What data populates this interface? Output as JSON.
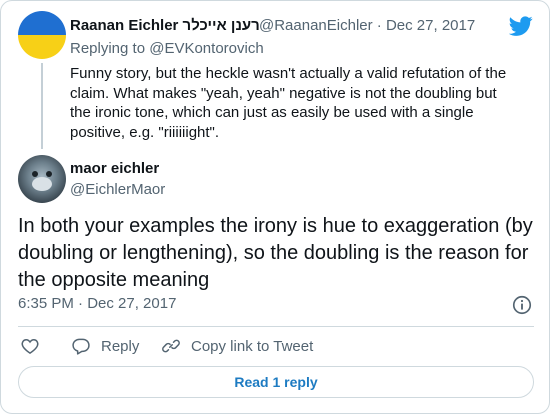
{
  "parent_tweet": {
    "display_name": "Raanan Eichler רענן אייכלר",
    "handle": "@RaananEichler",
    "separator": "·",
    "date": "Dec 27, 2017",
    "replying_label": "Replying to",
    "replying_handle": "@EVKontorovich",
    "text": "Funny story, but the heckle wasn't actually a valid refutation of the claim. What makes \"yeah, yeah\" negative is not the doubling but the ironic tone, which can just as easily be used with a single positive, e.g. \"riiiiiight\"."
  },
  "main_tweet": {
    "display_name": "maor eichler",
    "handle": "@EichlerMaor",
    "text": "In both your examples the irony is hue to exaggeration (by doubling or lengthening), so the doubling is the reason for the opposite meaning",
    "timestamp": "6:35 PM · Dec 27, 2017"
  },
  "actions": {
    "reply_label": "Reply",
    "copy_label": "Copy link to Tweet"
  },
  "read_replies_label": "Read 1 reply",
  "icons": {
    "brand": "twitter-bird-icon",
    "like": "heart-icon",
    "reply": "speech-bubble-icon",
    "copy": "link-icon",
    "info": "info-icon"
  },
  "colors": {
    "brand_blue": "#1d9bf0",
    "link_blue": "#1d7bc2",
    "muted_text": "#536471",
    "border": "#cfd9de",
    "flag_blue": "#1f6fd1",
    "flag_yellow": "#f7d017"
  }
}
